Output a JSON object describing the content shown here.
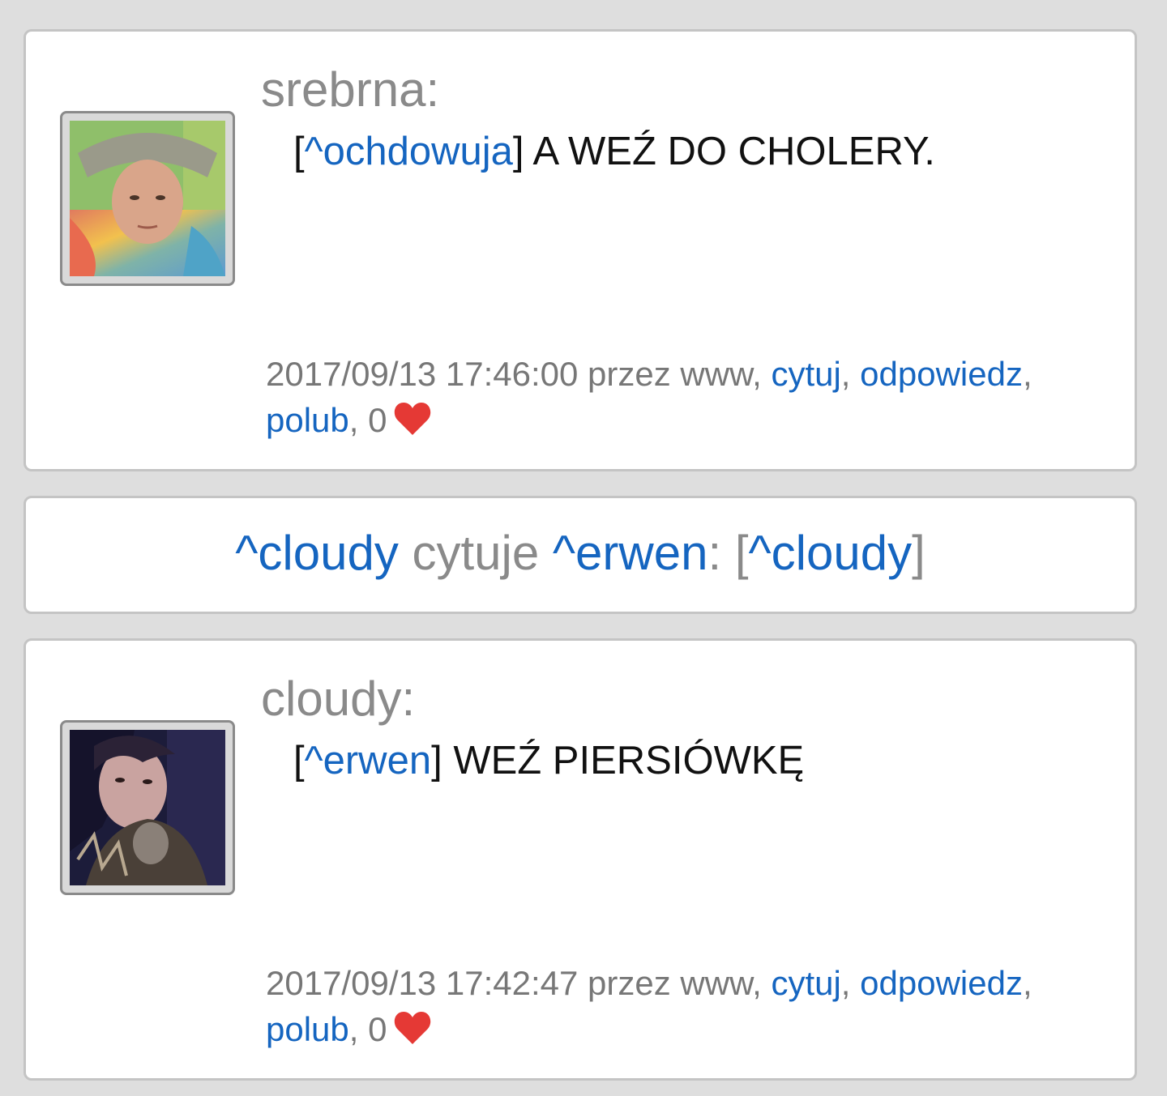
{
  "posts": [
    {
      "author": "srebrna:",
      "mention_open": "[",
      "mention": "^ochdowuja",
      "mention_close": "]",
      "text": " A WEŹ DO CHOLERY.",
      "datetime": "2017/09/13 17:46:00",
      "via": "przez www,",
      "cite": "cytuj",
      "reply": "odpowiedz",
      "like": "polub",
      "like_count": "0"
    },
    {
      "author": "cloudy:",
      "mention_open": "[",
      "mention": "^erwen",
      "mention_close": "]",
      "text": " WEŹ PIERSIÓWKĘ",
      "datetime": "2017/09/13 17:42:47",
      "via": "przez www,",
      "cite": "cytuj",
      "reply": "odpowiedz",
      "like": "polub",
      "like_count": "0"
    }
  ],
  "quote": {
    "user": "^cloudy",
    "verb": " cytuje ",
    "target": "^erwen",
    "colon": ": [",
    "ref": "^cloudy",
    "close": "]"
  },
  "colors": {
    "link": "#1565c0",
    "muted": "#8a8a8a",
    "heart": "#e53935",
    "background": "#dedede"
  },
  "icons": {
    "heart": "heart-icon"
  }
}
